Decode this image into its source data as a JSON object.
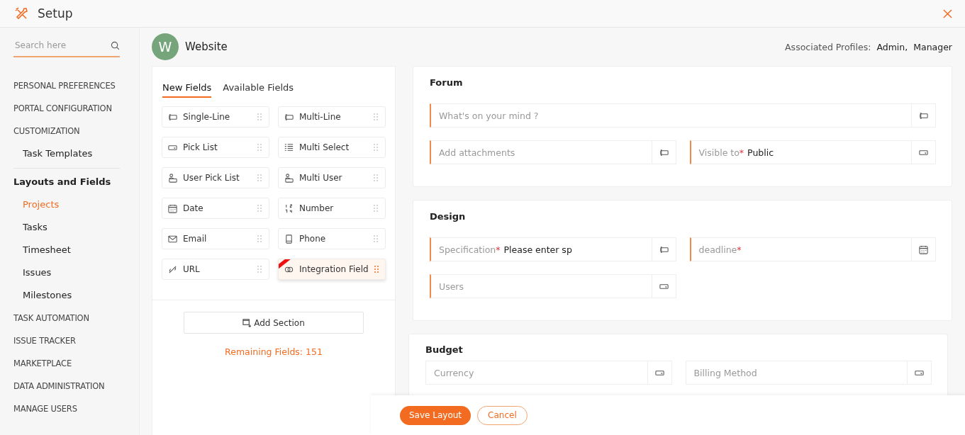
{
  "header": {
    "title": "Setup"
  },
  "sidebar": {
    "search": {
      "placeholder": "Search here"
    },
    "items": [
      {
        "label": "PERSONAL PREFERENCES",
        "kind": "category"
      },
      {
        "label": "PORTAL CONFIGURATION",
        "kind": "category"
      },
      {
        "label": "CUSTOMIZATION",
        "kind": "category",
        "children": [
          {
            "label": "Task Templates",
            "selected": false
          }
        ]
      },
      {
        "label": "Layouts and Fields",
        "kind": "group",
        "children": [
          {
            "label": "Projects",
            "selected": true
          },
          {
            "label": "Tasks",
            "selected": false
          },
          {
            "label": "Timesheet",
            "selected": false
          },
          {
            "label": "Issues",
            "selected": false
          },
          {
            "label": "Milestones",
            "selected": false
          }
        ]
      },
      {
        "label": "TASK AUTOMATION",
        "kind": "category"
      },
      {
        "label": "ISSUE TRACKER",
        "kind": "category"
      },
      {
        "label": "MARKETPLACE",
        "kind": "category"
      },
      {
        "label": "DATA ADMINISTRATION",
        "kind": "category"
      },
      {
        "label": "MANAGE USERS",
        "kind": "category"
      }
    ]
  },
  "layout": {
    "avatar": "W",
    "name": "Website",
    "profiles_label": "Associated Profiles:",
    "profiles": [
      "Admin,",
      "Manager"
    ]
  },
  "palette": {
    "tabs": [
      {
        "label": "New Fields",
        "selected": true
      },
      {
        "label": "Available Fields",
        "selected": false
      }
    ],
    "field_types": [
      {
        "label": "Single-Line",
        "kind": "single-line",
        "selected": false
      },
      {
        "label": "Multi-Line",
        "kind": "multi-line",
        "selected": false
      },
      {
        "label": "Pick List",
        "kind": "pick-list",
        "selected": false
      },
      {
        "label": "Multi Select",
        "kind": "multi-select",
        "selected": false
      },
      {
        "label": "User Pick List",
        "kind": "user",
        "selected": false
      },
      {
        "label": "Multi User",
        "kind": "multi-user",
        "selected": false
      },
      {
        "label": "Date",
        "kind": "date",
        "selected": false
      },
      {
        "label": "Number",
        "kind": "number",
        "selected": false
      },
      {
        "label": "Email",
        "kind": "email",
        "selected": false
      },
      {
        "label": "Phone",
        "kind": "phone",
        "selected": false
      },
      {
        "label": "URL",
        "kind": "url",
        "selected": false
      },
      {
        "label": "Integration Field",
        "kind": "integration",
        "selected": true
      }
    ],
    "add_section": "Add Section",
    "remaining": "Remaining Fields: 151"
  },
  "sections": [
    {
      "title": "Forum",
      "fields": [
        {
          "label": "What's on your mind ?",
          "kind": "text",
          "wide": true,
          "marked": true
        },
        {
          "label": "Add attachments",
          "kind": "text",
          "wide": false,
          "marked": true
        },
        {
          "label": "Visible to",
          "required_mark": "*",
          "value": "Public",
          "kind": "select",
          "wide": false,
          "marked": true
        }
      ]
    },
    {
      "title": "Design",
      "fields": [
        {
          "label": "Specification",
          "required_mark": "*",
          "value": "Please enter sp",
          "kind": "text",
          "wide": false,
          "marked": true
        },
        {
          "label": "deadline",
          "required_mark": "*",
          "kind": "date",
          "wide": false,
          "marked": true
        },
        {
          "label": "Users",
          "kind": "select",
          "wide": false,
          "marked": true
        }
      ]
    },
    {
      "title": "Budget",
      "fields": [
        {
          "label": "Currency",
          "kind": "select",
          "wide": false,
          "marked": false
        },
        {
          "label": "Billing Method",
          "kind": "select",
          "wide": false,
          "marked": false
        }
      ]
    }
  ],
  "footer": {
    "save": "Save Layout",
    "cancel": "Cancel"
  }
}
